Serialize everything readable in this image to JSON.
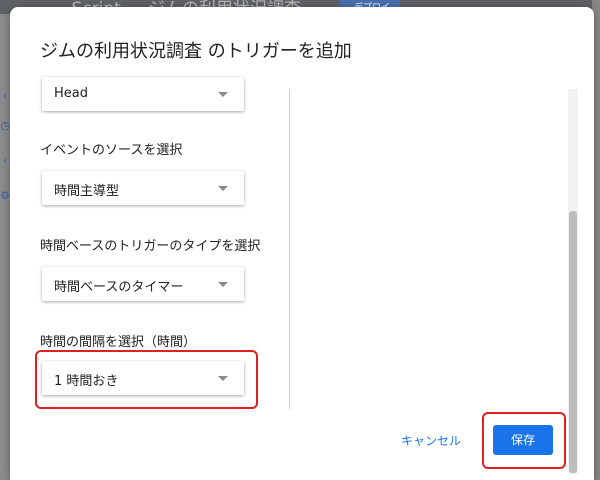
{
  "background": {
    "title": "- Script ... ジムの利用状況調査",
    "button_label": "デプロイ"
  },
  "dialog": {
    "title": "ジムの利用状況調査 のトリガーを追加",
    "first_select_value": "Head",
    "sections": [
      {
        "label": "イベントのソースを選択",
        "value": "時間主導型"
      },
      {
        "label": "時間ベースのトリガーのタイプを選択",
        "value": "時間ベースのタイマー"
      },
      {
        "label": "時間の間隔を選択（時間）",
        "value": "1 時間おき"
      }
    ],
    "cancel_label": "キャンセル",
    "save_label": "保存"
  },
  "colors": {
    "accent": "#1a73e8",
    "highlight": "#e02020"
  }
}
